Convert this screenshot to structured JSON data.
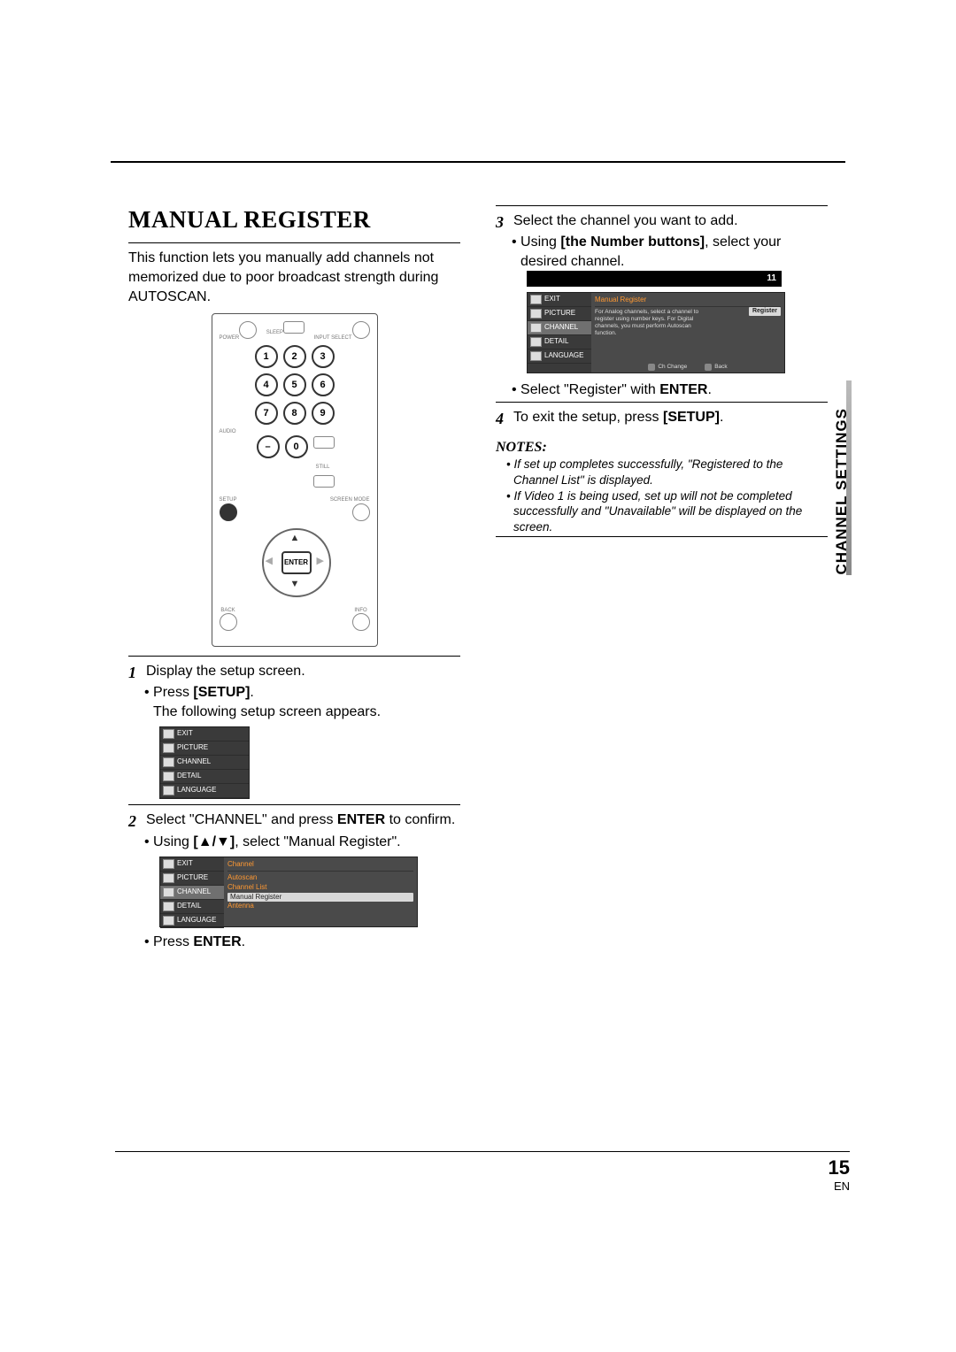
{
  "page": {
    "number": "15",
    "lang": "EN",
    "side_tab": "CHANNEL SETTINGS"
  },
  "title": "MANUAL REGISTER",
  "intro": "This function lets you manually add channels not memorized due to poor broadcast strength during AUTOSCAN.",
  "remote": {
    "labels": {
      "power": "POWER",
      "sleep": "SLEEP",
      "input_select": "INPUT SELECT",
      "audio": "AUDIO",
      "still": "STILL",
      "screen_mode": "SCREEN MODE",
      "setup": "SETUP",
      "enter": "ENTER",
      "back": "BACK",
      "info": "INFO"
    },
    "numbers": [
      "1",
      "2",
      "3",
      "4",
      "5",
      "6",
      "7",
      "8",
      "9",
      "–",
      "0"
    ]
  },
  "step1": {
    "text": "Display the setup screen.",
    "b1_pre": "Press ",
    "b1_bold": "[SETUP]",
    "b1_post": ".",
    "sub": "The following setup screen appears."
  },
  "osd_menu": {
    "items": [
      "EXIT",
      "PICTURE",
      "CHANNEL",
      "DETAIL",
      "LANGUAGE"
    ]
  },
  "step2": {
    "text_pre": "Select \"CHANNEL\" and press ",
    "text_bold": "ENTER",
    "text_post": " to confirm.",
    "b1_pre": "Using ",
    "b1_bold": "[▲/▼]",
    "b1_post": ", select \"Manual Register\".",
    "b2_pre": "Press ",
    "b2_bold": "ENTER",
    "b2_post": "."
  },
  "osd2": {
    "header": "Channel",
    "options": [
      "Autoscan",
      "Channel List",
      "Manual Register",
      "Antenna"
    ],
    "selected_index": 2
  },
  "step3": {
    "text": "Select the channel you want to add.",
    "b1_pre": "Using ",
    "b1_bold": "[the Number buttons]",
    "b1_post": ", select your desired channel.",
    "b2_pre": "Select \"Register\" with ",
    "b2_bold": "ENTER",
    "b2_post": "."
  },
  "osd3": {
    "channel_badge": "11",
    "header": "Manual Register",
    "hint": "For Analog channels, select a channel to register using number keys. For Digital channels, you must perform Autoscan function.",
    "register": "Register",
    "foot_change": "Ch Change",
    "foot_back": "Back"
  },
  "step4": {
    "text_pre": "To exit the setup, press ",
    "text_bold": "[SETUP]",
    "text_post": "."
  },
  "notes": {
    "heading": "NOTES:",
    "n1": "If set up completes successfully, \"Registered to the Channel List\" is displayed.",
    "n2": "If Video 1 is being used, set up will not be completed successfully and \"Unavailable\" will be displayed on the screen."
  }
}
